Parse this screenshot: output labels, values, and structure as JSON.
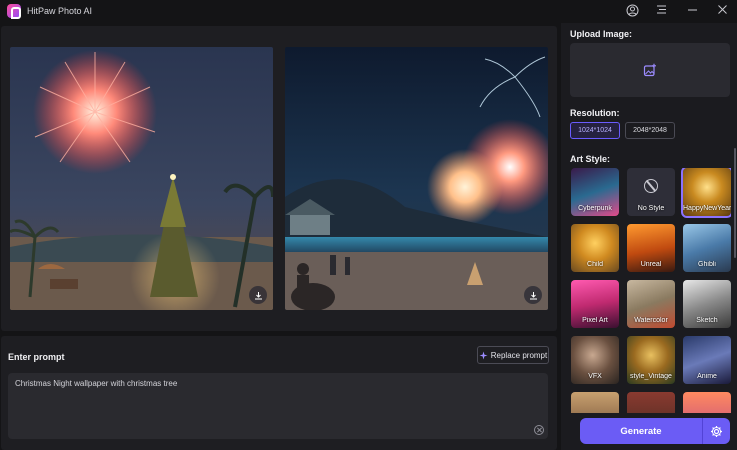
{
  "app": {
    "title": "HitPaw Photo AI"
  },
  "prompt": {
    "label": "Enter prompt",
    "replace_button": "Replace prompt",
    "text": "Christmas Night wallpaper with christmas tree"
  },
  "sidebar": {
    "upload_label": "Upload Image:",
    "resolution_label": "Resolution:",
    "resolutions": [
      "1024*1024",
      "2048*2048"
    ],
    "selected_resolution": "1024*1024",
    "art_style_label": "Art Style:",
    "styles": [
      {
        "name": "Cyberpunk"
      },
      {
        "name": "No Style"
      },
      {
        "name": "HappyNewYear"
      },
      {
        "name": "Child"
      },
      {
        "name": "Unreal"
      },
      {
        "name": "Ghibli"
      },
      {
        "name": "Pixel Art"
      },
      {
        "name": "Watercolor"
      },
      {
        "name": "Sketch"
      },
      {
        "name": "VFX"
      },
      {
        "name": "style_Vintage"
      },
      {
        "name": "Anime"
      }
    ],
    "selected_style": "HappyNewYear",
    "generate_label": "Generate"
  },
  "colors": {
    "accent": "#6b5cf5",
    "panel": "#1e1e22",
    "background": "#141416"
  }
}
